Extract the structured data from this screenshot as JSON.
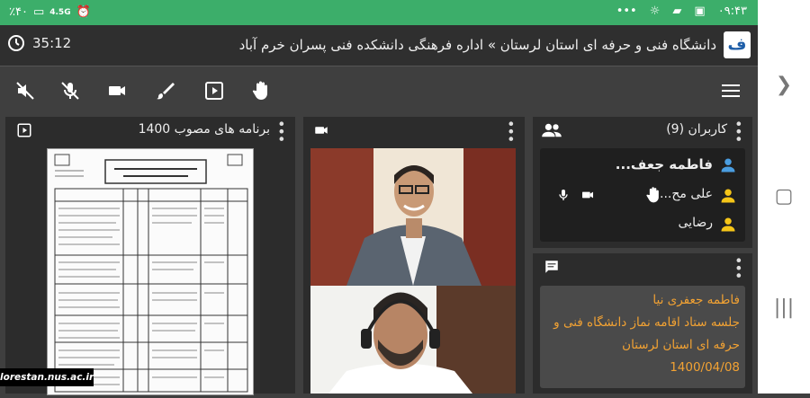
{
  "status_bar": {
    "time": "۰۹:۴۳",
    "battery": "٪۴۰",
    "network": "4.5G",
    "more": "•••"
  },
  "header": {
    "title": "دانشگاه فنی و حرفه ای استان لرستان » اداره فرهنگی دانشکده فنی پسران خرم آباد",
    "timer": "35:12"
  },
  "toolbar": {
    "icons": [
      "speaker-off-icon",
      "mic-off-icon",
      "camera-icon",
      "brush-icon",
      "play-icon",
      "hand-icon",
      "menu-icon"
    ]
  },
  "presentation": {
    "title": "برنامه های مصوب 1400"
  },
  "users": {
    "title": "کاربران (9)",
    "list": [
      {
        "name": "فاطمه جعف..."
      },
      {
        "name": "علی مح..."
      },
      {
        "name": "رضایی"
      }
    ]
  },
  "chat": {
    "author": "فاطمه جعفری نیا",
    "message": "جلسه ستاد اقامه نماز دانشگاه فنی و حرفه ای استان لرستان",
    "date": "1400/04/08"
  },
  "watermark": "lorestan.nus.ac.ir",
  "colors": {
    "status_green": "#3cae6a",
    "chat_orange": "#f2a233",
    "user_blue": "#4a9de0",
    "user_yellow": "#f5c518"
  }
}
